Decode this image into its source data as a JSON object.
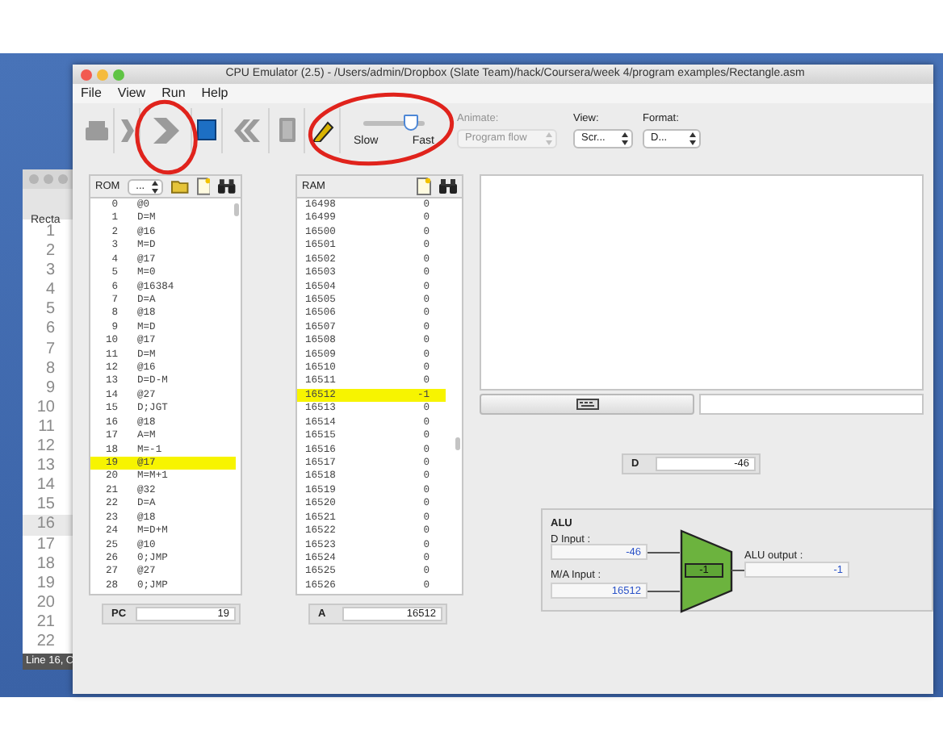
{
  "background_window": {
    "tab": "Recta",
    "lines": [
      {
        "number": "1",
        "selected": false
      },
      {
        "number": "2",
        "selected": false
      },
      {
        "number": "3",
        "selected": false
      },
      {
        "number": "4",
        "selected": false
      },
      {
        "number": "5",
        "selected": false
      },
      {
        "number": "6",
        "selected": false
      },
      {
        "number": "7",
        "selected": false
      },
      {
        "number": "8",
        "selected": false
      },
      {
        "number": "9",
        "selected": false
      },
      {
        "number": "10",
        "selected": false
      },
      {
        "number": "11",
        "selected": false
      },
      {
        "number": "12",
        "selected": false
      },
      {
        "number": "13",
        "selected": false
      },
      {
        "number": "14",
        "selected": false
      },
      {
        "number": "15",
        "selected": false
      },
      {
        "number": "16",
        "selected": true
      },
      {
        "number": "17",
        "selected": false
      },
      {
        "number": "18",
        "selected": false
      },
      {
        "number": "19",
        "selected": false
      },
      {
        "number": "20",
        "selected": false
      },
      {
        "number": "21",
        "selected": false
      },
      {
        "number": "22",
        "selected": false
      }
    ],
    "status": "Line 16, C"
  },
  "window": {
    "title": "CPU Emulator (2.5) - /Users/admin/Dropbox (Slate Team)/hack/Coursera/week 4/program examples/Rectangle.asm",
    "menu": [
      "File",
      "View",
      "Run",
      "Help"
    ]
  },
  "toolbar": {
    "buttons": [
      {
        "kind": "load",
        "disabled": true
      },
      {
        "kind": "step",
        "disabled": true
      },
      {
        "kind": "run",
        "disabled": true
      },
      {
        "kind": "stop",
        "disabled": false
      },
      {
        "kind": "rewind",
        "disabled": true
      },
      {
        "kind": "reset",
        "disabled": true
      },
      {
        "kind": "breakpoints",
        "disabled": false
      }
    ],
    "speed": {
      "level": 0.9,
      "slow_label": "Slow",
      "fast_label": "Fast"
    },
    "animate": {
      "label": "Animate:",
      "value": "Program flow",
      "disabled": true
    },
    "view": {
      "label": "View:",
      "value": "Scr..."
    },
    "format": {
      "label": "Format:",
      "value": "D..."
    }
  },
  "rom": {
    "title": "ROM",
    "format": "...",
    "rows": [
      {
        "address": "0",
        "instruction": "@0",
        "selected": false
      },
      {
        "address": "1",
        "instruction": "D=M",
        "selected": false
      },
      {
        "address": "2",
        "instruction": "@16",
        "selected": false
      },
      {
        "address": "3",
        "instruction": "M=D",
        "selected": false
      },
      {
        "address": "4",
        "instruction": "@17",
        "selected": false
      },
      {
        "address": "5",
        "instruction": "M=0",
        "selected": false
      },
      {
        "address": "6",
        "instruction": "@16384",
        "selected": false
      },
      {
        "address": "7",
        "instruction": "D=A",
        "selected": false
      },
      {
        "address": "8",
        "instruction": "@18",
        "selected": false
      },
      {
        "address": "9",
        "instruction": "M=D",
        "selected": false
      },
      {
        "address": "10",
        "instruction": "@17",
        "selected": false
      },
      {
        "address": "11",
        "instruction": "D=M",
        "selected": false
      },
      {
        "address": "12",
        "instruction": "@16",
        "selected": false
      },
      {
        "address": "13",
        "instruction": "D=D-M",
        "selected": false
      },
      {
        "address": "14",
        "instruction": "@27",
        "selected": false
      },
      {
        "address": "15",
        "instruction": "D;JGT",
        "selected": false
      },
      {
        "address": "16",
        "instruction": "@18",
        "selected": false
      },
      {
        "address": "17",
        "instruction": "A=M",
        "selected": false
      },
      {
        "address": "18",
        "instruction": "M=-1",
        "selected": false
      },
      {
        "address": "19",
        "instruction": "@17",
        "selected": true
      },
      {
        "address": "20",
        "instruction": "M=M+1",
        "selected": false
      },
      {
        "address": "21",
        "instruction": "@32",
        "selected": false
      },
      {
        "address": "22",
        "instruction": "D=A",
        "selected": false
      },
      {
        "address": "23",
        "instruction": "@18",
        "selected": false
      },
      {
        "address": "24",
        "instruction": "M=D+M",
        "selected": false
      },
      {
        "address": "25",
        "instruction": "@10",
        "selected": false
      },
      {
        "address": "26",
        "instruction": "0;JMP",
        "selected": false
      },
      {
        "address": "27",
        "instruction": "@27",
        "selected": false
      },
      {
        "address": "28",
        "instruction": "0;JMP",
        "selected": false
      }
    ]
  },
  "pc": {
    "label": "PC",
    "value": "19"
  },
  "ram": {
    "title": "RAM",
    "rows": [
      {
        "address": "16498",
        "value": "0",
        "selected": false
      },
      {
        "address": "16499",
        "value": "0",
        "selected": false
      },
      {
        "address": "16500",
        "value": "0",
        "selected": false
      },
      {
        "address": "16501",
        "value": "0",
        "selected": false
      },
      {
        "address": "16502",
        "value": "0",
        "selected": false
      },
      {
        "address": "16503",
        "value": "0",
        "selected": false
      },
      {
        "address": "16504",
        "value": "0",
        "selected": false
      },
      {
        "address": "16505",
        "value": "0",
        "selected": false
      },
      {
        "address": "16506",
        "value": "0",
        "selected": false
      },
      {
        "address": "16507",
        "value": "0",
        "selected": false
      },
      {
        "address": "16508",
        "value": "0",
        "selected": false
      },
      {
        "address": "16509",
        "value": "0",
        "selected": false
      },
      {
        "address": "16510",
        "value": "0",
        "selected": false
      },
      {
        "address": "16511",
        "value": "0",
        "selected": false
      },
      {
        "address": "16512",
        "value": "-1",
        "selected": true
      },
      {
        "address": "16513",
        "value": "0",
        "selected": false
      },
      {
        "address": "16514",
        "value": "0",
        "selected": false
      },
      {
        "address": "16515",
        "value": "0",
        "selected": false
      },
      {
        "address": "16516",
        "value": "0",
        "selected": false
      },
      {
        "address": "16517",
        "value": "0",
        "selected": false
      },
      {
        "address": "16518",
        "value": "0",
        "selected": false
      },
      {
        "address": "16519",
        "value": "0",
        "selected": false
      },
      {
        "address": "16520",
        "value": "0",
        "selected": false
      },
      {
        "address": "16521",
        "value": "0",
        "selected": false
      },
      {
        "address": "16522",
        "value": "0",
        "selected": false
      },
      {
        "address": "16523",
        "value": "0",
        "selected": false
      },
      {
        "address": "16524",
        "value": "0",
        "selected": false
      },
      {
        "address": "16525",
        "value": "0",
        "selected": false
      },
      {
        "address": "16526",
        "value": "0",
        "selected": false
      }
    ]
  },
  "a": {
    "label": "A",
    "value": "16512"
  },
  "d": {
    "label": "D",
    "value": "-46"
  },
  "alu": {
    "title": "ALU",
    "d_label": "D Input :",
    "d_value": "-46",
    "ma_label": "M/A Input :",
    "ma_value": "16512",
    "operation": "-1",
    "output_label": "ALU output :",
    "output_value": "-1"
  },
  "annotations": [
    {
      "kind": "ellipse"
    },
    {
      "kind": "ellipse"
    }
  ]
}
